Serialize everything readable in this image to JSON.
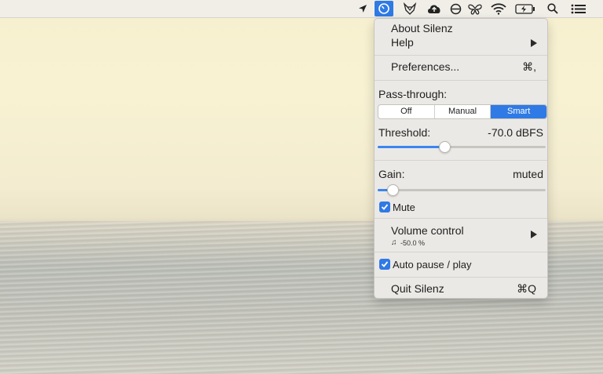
{
  "menubar": {
    "icons": [
      "location-arrow-icon",
      "silenz-dial-icon",
      "fox-icon",
      "cloud-upload-icon",
      "circle-slash-icon",
      "butterfly-icon",
      "wifi-icon",
      "battery-charging-icon",
      "search-icon",
      "list-icon"
    ]
  },
  "menu": {
    "about": "About Silenz",
    "help": "Help",
    "preferences": "Preferences...",
    "preferences_shortcut": "⌘,",
    "passthrough_label": "Pass-through:",
    "passthrough_options": [
      "Off",
      "Manual",
      "Smart"
    ],
    "passthrough_selected": "Smart",
    "threshold_label": "Threshold:",
    "threshold_value": "-70.0 dBFS",
    "threshold_level": 0.4,
    "gain_label": "Gain:",
    "gain_value": "muted",
    "gain_level": 0.09,
    "mute_label": "Mute",
    "mute_checked": true,
    "volume_control": "Volume control",
    "volume_note": "♫",
    "volume_value": "-50.0 %",
    "auto_pause": "Auto pause / play",
    "auto_pause_checked": true,
    "quit": "Quit Silenz",
    "quit_shortcut": "⌘Q"
  },
  "colors": {
    "accent": "#2f7ae5",
    "menu_bg": "#ebe9e5"
  }
}
